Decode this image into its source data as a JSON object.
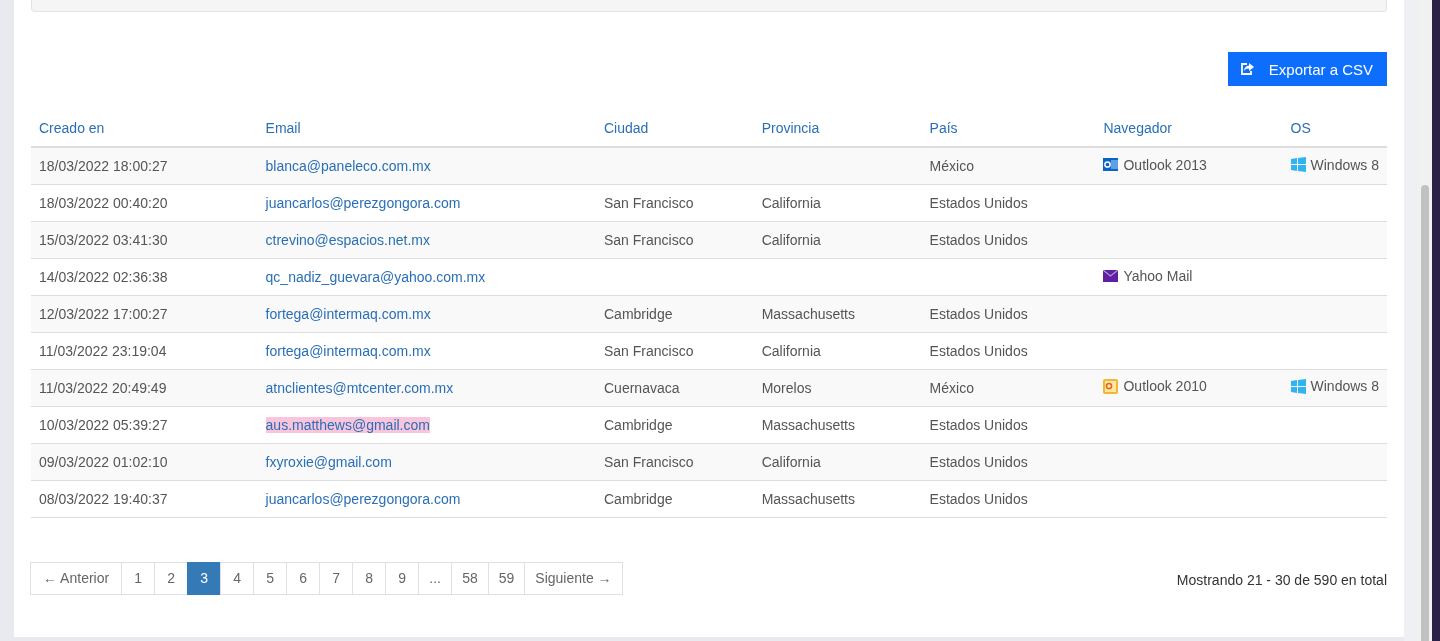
{
  "export_button": {
    "label": "Exportar a CSV"
  },
  "table": {
    "columns": [
      "Creado en",
      "Email",
      "Ciudad",
      "Provincia",
      "País",
      "Navegador",
      "OS"
    ],
    "rows": [
      {
        "created": "18/03/2022 18:00:27",
        "email": "blanca@paneleco.com.mx",
        "highlighted": false,
        "city": "",
        "province": "",
        "country": "México",
        "browser": {
          "kind": "outlook2013",
          "label": "Outlook 2013"
        },
        "os": {
          "kind": "windows",
          "label": "Windows 8"
        }
      },
      {
        "created": "18/03/2022 00:40:20",
        "email": "juancarlos@perezgongora.com",
        "highlighted": false,
        "city": "San Francisco",
        "province": "California",
        "country": "Estados Unidos"
      },
      {
        "created": "15/03/2022 03:41:30",
        "email": "ctrevino@espacios.net.mx",
        "highlighted": false,
        "city": "San Francisco",
        "province": "California",
        "country": "Estados Unidos"
      },
      {
        "created": "14/03/2022 02:36:38",
        "email": "qc_nadiz_guevara@yahoo.com.mx",
        "highlighted": false,
        "city": "",
        "province": "",
        "country": "",
        "browser": {
          "kind": "yahoo",
          "label": "Yahoo Mail"
        }
      },
      {
        "created": "12/03/2022 17:00:27",
        "email": "fortega@intermaq.com.mx",
        "highlighted": false,
        "city": "Cambridge",
        "province": "Massachusetts",
        "country": "Estados Unidos"
      },
      {
        "created": "11/03/2022 23:19:04",
        "email": "fortega@intermaq.com.mx",
        "highlighted": false,
        "city": "San Francisco",
        "province": "California",
        "country": "Estados Unidos"
      },
      {
        "created": "11/03/2022 20:49:49",
        "email": "atnclientes@mtcenter.com.mx",
        "highlighted": false,
        "city": "Cuernavaca",
        "province": "Morelos",
        "country": "México",
        "browser": {
          "kind": "outlook2010",
          "label": "Outlook 2010"
        },
        "os": {
          "kind": "windows",
          "label": "Windows 8"
        }
      },
      {
        "created": "10/03/2022 05:39:27",
        "email": "aus.matthews@gmail.com",
        "highlighted": true,
        "city": "Cambridge",
        "province": "Massachusetts",
        "country": "Estados Unidos"
      },
      {
        "created": "09/03/2022 01:02:10",
        "email": "fxyroxie@gmail.com",
        "highlighted": false,
        "city": "San Francisco",
        "province": "California",
        "country": "Estados Unidos"
      },
      {
        "created": "08/03/2022 19:40:37",
        "email": "juancarlos@perezgongora.com",
        "highlighted": false,
        "city": "Cambridge",
        "province": "Massachusetts",
        "country": "Estados Unidos"
      }
    ]
  },
  "pagination": {
    "pages": [
      {
        "label": "← Anterior",
        "selected": false
      },
      {
        "label": "1",
        "selected": false
      },
      {
        "label": "2",
        "selected": false
      },
      {
        "label": "3",
        "selected": true
      },
      {
        "label": "4",
        "selected": false
      },
      {
        "label": "5",
        "selected": false
      },
      {
        "label": "6",
        "selected": false
      },
      {
        "label": "7",
        "selected": false
      },
      {
        "label": "8",
        "selected": false
      },
      {
        "label": "9",
        "selected": false
      },
      {
        "label": "...",
        "selected": false
      },
      {
        "label": "58",
        "selected": false
      },
      {
        "label": "59",
        "selected": false
      },
      {
        "label": "Siguiente →",
        "selected": false
      }
    ],
    "summary": "Mostrando 21 - 30 de 590 en total"
  }
}
